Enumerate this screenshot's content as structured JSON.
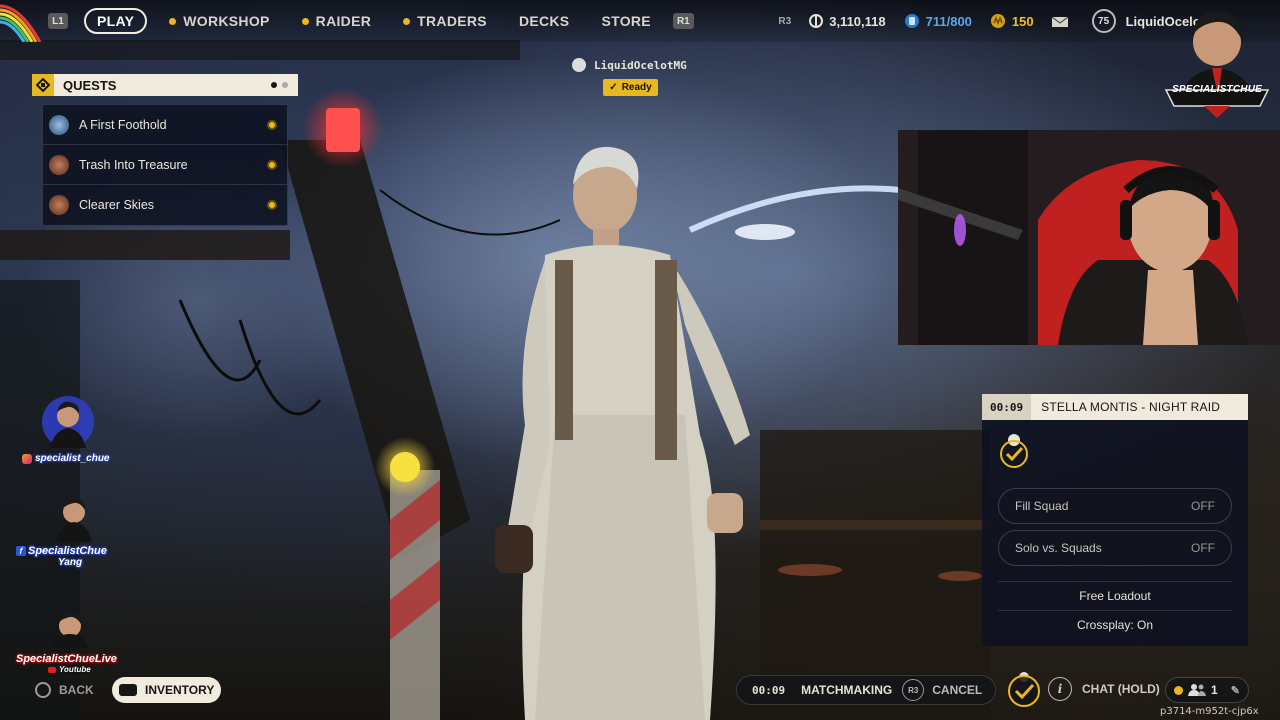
{
  "topbar": {
    "left_hint": "L1",
    "right_hint": "R1",
    "nav": [
      {
        "label": "PLAY",
        "active": true
      },
      {
        "label": "WORKSHOP",
        "dot": true
      },
      {
        "label": "RAIDER",
        "dot": true
      },
      {
        "label": "TRADERS",
        "dot": true
      },
      {
        "label": "DECKS"
      },
      {
        "label": "STORE"
      }
    ],
    "r3_hint": "R3",
    "currency_coins": "3,110,118",
    "stash": "711/800",
    "raider_tokens": "150",
    "player_level": "75",
    "player_name": "LiquidOcelotMG",
    "streamer_logo_text": "SPECIALISTCHUE"
  },
  "quests": {
    "title": "QUESTS",
    "items": [
      {
        "label": "A First Foothold"
      },
      {
        "label": "Trash Into Treasure"
      },
      {
        "label": "Clearer Skies"
      }
    ]
  },
  "lobby": {
    "player_name": "LiquidOcelotMG",
    "ready_label": "Ready"
  },
  "raid": {
    "timer": "00:09",
    "title": "STELLA MONTIS - NIGHT RAID",
    "fill_squad_label": "Fill Squad",
    "fill_squad_value": "OFF",
    "solo_label": "Solo vs. Squads",
    "solo_value": "OFF",
    "loadout": "Free Loadout",
    "crossplay": "Crossplay: On"
  },
  "social": {
    "instagram": "specialist_chue",
    "facebook_line1": "SpecialistChue",
    "facebook_line2": "Yang",
    "youtube_line1": "SpecialistChueLive",
    "youtube_line2": "Youtube"
  },
  "bottom": {
    "back_label": "BACK",
    "inventory_label": "INVENTORY",
    "mm_timer": "00:09",
    "matchmaking_label": "MATCHMAKING",
    "r3_hint": "R3",
    "cancel_label": "CANCEL",
    "chat_label": "CHAT (HOLD)",
    "party_count": "1",
    "session_id": "p3714-m952t-cjp6x"
  },
  "colors": {
    "accent": "#e8b820",
    "panel": "#0e1220",
    "cream": "#f0ebdc"
  }
}
